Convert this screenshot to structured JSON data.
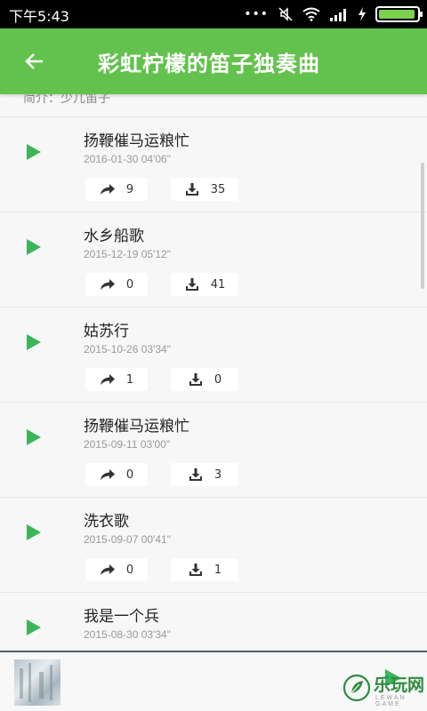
{
  "status_bar": {
    "time": "下午5:43",
    "battery_level": 0.95
  },
  "app_bar": {
    "back_icon": "arrow-left-icon",
    "title": "彩虹柠檬的笛子独奏曲"
  },
  "intro": {
    "text": "简介：少儿笛子"
  },
  "songs": [
    {
      "title": "扬鞭催马运粮忙",
      "date": "2016-01-30",
      "duration": "04'06\"",
      "shares": "9",
      "downloads": "35"
    },
    {
      "title": "水乡船歌",
      "date": "2015-12-19",
      "duration": "05'12\"",
      "shares": "0",
      "downloads": "41"
    },
    {
      "title": "姑苏行",
      "date": "2015-10-26",
      "duration": "03'34\"",
      "shares": "1",
      "downloads": "0"
    },
    {
      "title": "扬鞭催马运粮忙",
      "date": "2015-09-11",
      "duration": "03'00\"",
      "shares": "0",
      "downloads": "3"
    },
    {
      "title": "洗衣歌",
      "date": "2015-09-07",
      "duration": "00'41\"",
      "shares": "0",
      "downloads": "1"
    },
    {
      "title": "我是一个兵",
      "date": "2015-08-30",
      "duration": "03'34\"",
      "shares": "",
      "downloads": ""
    }
  ],
  "watermark": {
    "text": "乐玩网",
    "sub": "LEWAN GAME"
  },
  "colors": {
    "accent": "#63c24d",
    "play_icon": "#3cb55a"
  }
}
